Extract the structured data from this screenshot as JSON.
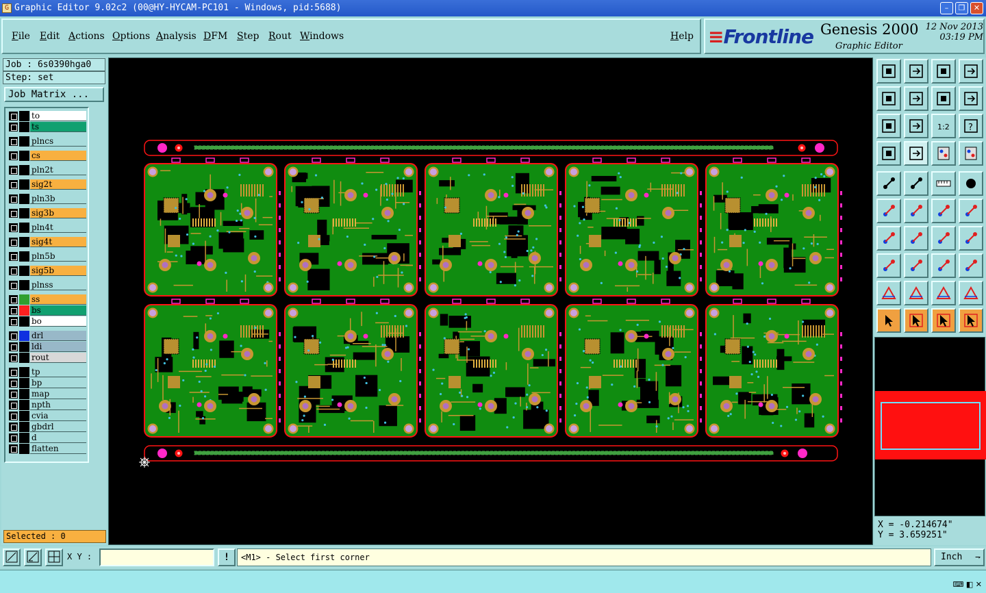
{
  "window": {
    "title": "Graphic Editor 9.02c2 (00@HY-HYCAM-PC101 - Windows, pid:5688)",
    "min_label": "–",
    "max_label": "❐",
    "close_label": "✕"
  },
  "menu": {
    "items": [
      "File",
      "Edit",
      "Actions",
      "Options",
      "Analysis",
      "DFM",
      "Step",
      "Rout",
      "Windows"
    ],
    "help": "Help"
  },
  "brand": {
    "logo": "Frontline",
    "product": "Genesis 2000",
    "subtitle": "Graphic Editor",
    "date": "12 Nov 2013",
    "time": "03:19 PM"
  },
  "job": {
    "job_line": "Job : 6s0390hga0",
    "step_line": "Step: set",
    "matrix_button": "Job Matrix ..."
  },
  "layers": [
    {
      "name": "to",
      "color": "#ffffff",
      "swatch": "#000000"
    },
    {
      "name": "ts",
      "color": "#10a070",
      "swatch": "#000000"
    },
    {
      "name": "plncs",
      "color": "#a8dcdc",
      "swatch": "#000000"
    },
    {
      "name": "cs",
      "color": "#f8b040",
      "swatch": "#000000"
    },
    {
      "name": "pln2t",
      "color": "#a8dcdc",
      "swatch": "#000000"
    },
    {
      "name": "sig2t",
      "color": "#f8b040",
      "swatch": "#000000"
    },
    {
      "name": "pln3b",
      "color": "#a8dcdc",
      "swatch": "#000000"
    },
    {
      "name": "sig3b",
      "color": "#f8b040",
      "swatch": "#000000"
    },
    {
      "name": "pln4t",
      "color": "#a8dcdc",
      "swatch": "#000000"
    },
    {
      "name": "sig4t",
      "color": "#f8b040",
      "swatch": "#000000"
    },
    {
      "name": "pln5b",
      "color": "#a8dcdc",
      "swatch": "#000000"
    },
    {
      "name": "sig5b",
      "color": "#f8b040",
      "swatch": "#000000"
    },
    {
      "name": "plnss",
      "color": "#a8dcdc",
      "swatch": "#000000"
    },
    {
      "name": "ss",
      "color": "#f8b040",
      "swatch": "#30a030"
    },
    {
      "name": "bs",
      "color": "#10a070",
      "swatch": "#ff2020"
    },
    {
      "name": "bo",
      "color": "#ffffff",
      "swatch": "#000000"
    },
    {
      "name": "drl",
      "color": "#98b8c8",
      "swatch": "#1030e0"
    },
    {
      "name": "ldi",
      "color": "#98b8c8",
      "swatch": "#000000"
    },
    {
      "name": "rout",
      "color": "#d8d8d8",
      "swatch": "#000000"
    },
    {
      "name": "tp",
      "color": "#a8dcdc",
      "swatch": "#000000"
    },
    {
      "name": "bp",
      "color": "#a8dcdc",
      "swatch": "#000000"
    },
    {
      "name": "map",
      "color": "#a8dcdc",
      "swatch": "#000000"
    },
    {
      "name": "npth",
      "color": "#a8dcdc",
      "swatch": "#000000"
    },
    {
      "name": "cvia",
      "color": "#a8dcdc",
      "swatch": "#000000"
    },
    {
      "name": "gbdrl",
      "color": "#a8dcdc",
      "swatch": "#000000"
    },
    {
      "name": "d",
      "color": "#a8dcdc",
      "swatch": "#000000"
    },
    {
      "name": "flatten",
      "color": "#a8dcdc",
      "swatch": "#000000"
    }
  ],
  "selected": "Selected : 0",
  "coords": {
    "x": "X = -0.214674\"",
    "y": "Y = 3.659251\""
  },
  "status": {
    "xy_label": "X Y :",
    "xy_value": "",
    "prompt": "<M1> - Select first corner",
    "units": "Inch",
    "warn_label": "!"
  },
  "panel": {
    "rows": 2,
    "cols": 5
  },
  "colors": {
    "board_green": "#108c10",
    "copper": "#c89632",
    "outline": "#ff1414",
    "fiducial": "#ff28c8",
    "accent_orange": "#f8b040"
  },
  "toolbar_icons": [
    "zoom-home-icon",
    "zoom-in-icon",
    "home-icon",
    "fit-icon",
    "pan-left-icon",
    "pan-right-icon",
    "mirror-icon",
    "redraw-icon",
    "fit-all-icon",
    "zoom-fit-icon",
    "scale-icon",
    "help-icon",
    "snap-icon",
    "grid-icon",
    "layers-top-icon",
    "layers-bottom-icon",
    "measure-icon",
    "draw-icon",
    "ruler-icon",
    "pad-icon",
    "node-icon",
    "cross-icon",
    "line-point-icon",
    "line-icon",
    "angle-icon",
    "slash-icon",
    "rotate-icon",
    "flip-icon",
    "move-icon",
    "minus-icon",
    "resize-icon",
    "copy-icon",
    "tri-icon",
    "tri-arrow-icon",
    "tri-red-icon",
    "tri-blue-icon",
    "pointer-icon",
    "select-box-icon",
    "select-poly-icon",
    "select-net-icon"
  ]
}
